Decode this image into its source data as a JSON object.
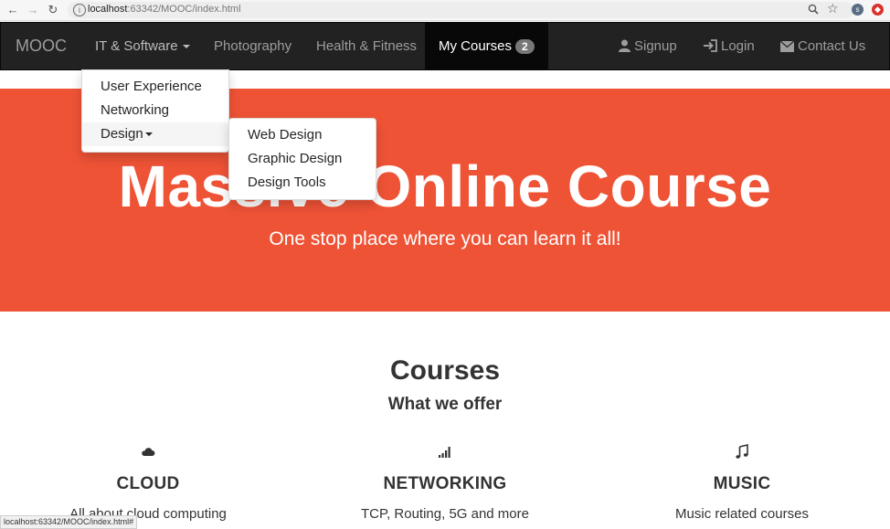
{
  "browser": {
    "url_host": "localhost",
    "url_path": ":63342/MOOC/index.html",
    "ext1_label": "s",
    "ext2_label": "◆"
  },
  "navbar": {
    "brand": "MOOC",
    "items": [
      {
        "label": "IT & Software",
        "has_caret": true
      },
      {
        "label": "Photography"
      },
      {
        "label": "Health & Fitness"
      },
      {
        "label": "My Courses",
        "badge": "2",
        "active": true
      }
    ],
    "right_items": [
      {
        "label": "Signup",
        "icon": "user-icon"
      },
      {
        "label": "Login",
        "icon": "login-icon"
      },
      {
        "label": "Contact Us",
        "icon": "envelope-icon"
      }
    ]
  },
  "dropdown_main": {
    "items": [
      {
        "label": "User Experience"
      },
      {
        "label": "Networking"
      },
      {
        "label": "Design",
        "has_caret": true,
        "hovered": true
      }
    ]
  },
  "dropdown_design": {
    "items": [
      {
        "label": "Web Design"
      },
      {
        "label": "Graphic Design"
      },
      {
        "label": "Design Tools"
      }
    ]
  },
  "hero": {
    "title": "Massive Online Course",
    "subtitle": "One stop place where you can learn it all!"
  },
  "courses": {
    "title": "Courses",
    "subtitle": "What we offer",
    "features": [
      {
        "icon": "cloud-icon",
        "title": "CLOUD",
        "desc": "All about cloud computing"
      },
      {
        "icon": "signal-icon",
        "title": "NETWORKING",
        "desc": "TCP, Routing, 5G and more"
      },
      {
        "icon": "music-icon",
        "title": "MUSIC",
        "desc": "Music related courses"
      }
    ]
  },
  "statusbar": {
    "text": "localhost:63342/MOOC/index.html#"
  },
  "colors": {
    "navbar_bg": "#222222",
    "hero_bg": "#ef5336",
    "badge_bg": "#777777"
  }
}
